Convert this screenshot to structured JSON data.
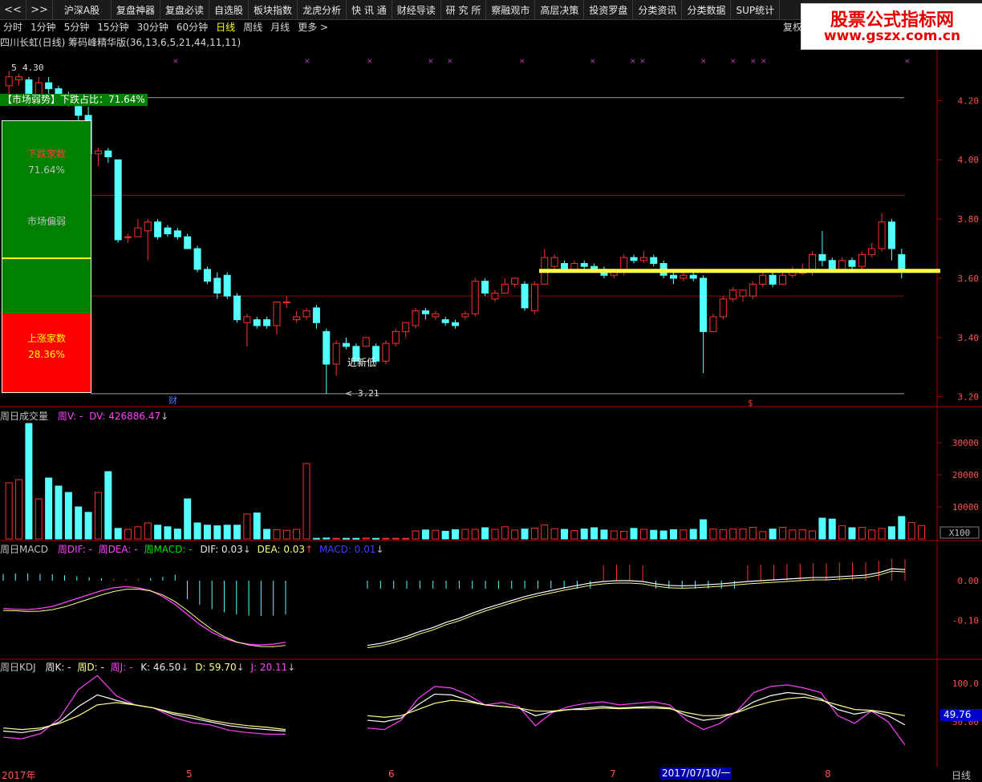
{
  "menu": {
    "nav_back": "<<",
    "nav_fwd": ">>",
    "items": [
      "沪深A股",
      "复盘神器",
      "复盘必读",
      "自选股",
      "板块指数",
      "龙虎分析",
      "快 讯 通",
      "财经导读",
      "研 究 所",
      "察融观市",
      "高层决策",
      "投资罗盘",
      "分类资讯",
      "分类数据",
      "SUP统计"
    ]
  },
  "periods": [
    "分时",
    "1分钟",
    "5分钟",
    "15分钟",
    "30分钟",
    "60分钟",
    "日线",
    "周线",
    "月线",
    "更多 >"
  ],
  "active_period": "日线",
  "restore_label": "复权",
  "watermark": {
    "line1": "股票公式指标网",
    "line2": "www.gszx.com.cn"
  },
  "chart_title": "四川长虹(日线) 筹码峰精华版(36,13,6,5,21,44,11,11)",
  "sentiment": {
    "badge": "【市场弱势】下跌占比：71.64%",
    "down_label": "下跌家数",
    "down_pct": "71.64%",
    "state": "市场偏弱",
    "up_label": "上涨家数",
    "up_pct": "28.36%",
    "colors": {
      "weak": "#008000",
      "up": "#ff0000",
      "divider": "#ffff00"
    }
  },
  "price_annotations": {
    "high_label": "4.30",
    "new_low_label": "近新低",
    "low_label": "3.21",
    "event_cai": "财",
    "event_s": "$"
  },
  "price_axis": [
    "4.20",
    "4.00",
    "3.80",
    "3.60",
    "3.40",
    "3.20"
  ],
  "volume": {
    "header_name": "周日成交量",
    "header_v": "周V: -",
    "header_dv": "DV: 426886.47",
    "axis": [
      "30000",
      "20000",
      "10000"
    ],
    "unit": "X100"
  },
  "macd": {
    "header_name": "周日MACD",
    "dif_label": "周DIF: -",
    "dea_label": "周DEA: -",
    "macd_label": "周MACD: -",
    "dif_val": "DIF: 0.03",
    "dea_val": "DEA: 0.03",
    "macd_val": "MACD: 0.01",
    "axis": [
      "0.00",
      "-0.10"
    ]
  },
  "kdj": {
    "header_name": "周日KDJ",
    "k_label": "周K: -",
    "d_label": "周D: -",
    "j_label": "周J: -",
    "k_val": "K: 46.50",
    "d_val": "D: 59.70",
    "j_val": "J: 20.11",
    "axis": [
      "100.0",
      "50.00"
    ],
    "current": "49.76"
  },
  "time_axis": {
    "labels": [
      "2017年",
      "5",
      "6",
      "7",
      "8"
    ],
    "cursor_date": "2017/07/10/一",
    "period_name": "日线"
  },
  "chart_data": {
    "type": "candlestick",
    "ylim": [
      3.18,
      4.35
    ],
    "candles": [
      [
        4.25,
        4.28,
        4.2,
        4.3
      ],
      [
        4.27,
        4.28,
        4.25,
        4.29
      ],
      [
        4.27,
        4.22,
        4.18,
        4.28
      ],
      [
        4.22,
        4.26,
        4.2,
        4.28
      ],
      [
        4.26,
        4.24,
        4.22,
        4.28
      ],
      [
        4.24,
        4.22,
        4.2,
        4.25
      ],
      [
        4.22,
        4.2,
        4.18,
        4.23
      ],
      [
        4.18,
        4.15,
        4.12,
        4.19
      ],
      [
        4.15,
        4.02,
        4.0,
        4.18
      ],
      [
        4.02,
        4.03,
        3.98,
        4.04
      ],
      [
        4.03,
        4.01,
        3.99,
        4.04
      ],
      [
        4.0,
        3.73,
        3.72,
        4.0
      ],
      [
        3.74,
        3.74,
        3.72,
        3.75
      ],
      [
        3.74,
        3.77,
        3.74,
        3.8
      ],
      [
        3.76,
        3.79,
        3.66,
        3.8
      ],
      [
        3.79,
        3.74,
        3.73,
        3.8
      ],
      [
        3.77,
        3.75,
        3.74,
        3.78
      ],
      [
        3.76,
        3.74,
        3.73,
        3.77
      ],
      [
        3.74,
        3.7,
        3.7,
        3.75
      ],
      [
        3.7,
        3.63,
        3.62,
        3.71
      ],
      [
        3.63,
        3.59,
        3.58,
        3.64
      ],
      [
        3.6,
        3.55,
        3.53,
        3.62
      ],
      [
        3.61,
        3.54,
        3.53,
        3.62
      ],
      [
        3.54,
        3.46,
        3.45,
        3.55
      ],
      [
        3.45,
        3.47,
        3.37,
        3.48
      ],
      [
        3.46,
        3.44,
        3.43,
        3.47
      ],
      [
        3.46,
        3.44,
        3.43,
        3.47
      ],
      [
        3.44,
        3.52,
        3.41,
        3.52
      ],
      [
        3.52,
        3.52,
        3.5,
        3.54
      ],
      [
        3.46,
        3.47,
        3.45,
        3.49
      ],
      [
        3.47,
        3.49,
        3.46,
        3.5
      ],
      [
        3.5,
        3.45,
        3.43,
        3.51
      ],
      [
        3.42,
        3.31,
        3.21,
        3.43
      ],
      [
        3.31,
        3.38,
        3.27,
        3.39
      ],
      [
        3.38,
        3.37,
        3.36,
        3.4
      ],
      [
        3.37,
        3.32,
        3.32,
        3.38
      ],
      [
        3.37,
        3.4,
        3.38,
        3.4
      ],
      [
        3.37,
        3.32,
        3.31,
        3.38
      ],
      [
        3.32,
        3.38,
        3.31,
        3.39
      ],
      [
        3.38,
        3.42,
        3.37,
        3.43
      ],
      [
        3.42,
        3.45,
        3.4,
        3.45
      ],
      [
        3.44,
        3.49,
        3.43,
        3.5
      ],
      [
        3.49,
        3.48,
        3.46,
        3.5
      ],
      [
        3.47,
        3.48,
        3.46,
        3.49
      ],
      [
        3.46,
        3.45,
        3.44,
        3.47
      ],
      [
        3.45,
        3.44,
        3.43,
        3.46
      ],
      [
        3.47,
        3.48,
        3.46,
        3.49
      ],
      [
        3.48,
        3.59,
        3.47,
        3.6
      ],
      [
        3.59,
        3.55,
        3.54,
        3.6
      ],
      [
        3.53,
        3.55,
        3.52,
        3.56
      ],
      [
        3.55,
        3.58,
        3.55,
        3.6
      ],
      [
        3.58,
        3.6,
        3.57,
        3.6
      ],
      [
        3.58,
        3.5,
        3.49,
        3.59
      ],
      [
        3.49,
        3.58,
        3.48,
        3.59
      ],
      [
        3.58,
        3.67,
        3.58,
        3.7
      ],
      [
        3.64,
        3.67,
        3.63,
        3.68
      ],
      [
        3.65,
        3.63,
        3.62,
        3.66
      ],
      [
        3.62,
        3.65,
        3.62,
        3.66
      ],
      [
        3.65,
        3.64,
        3.63,
        3.66
      ],
      [
        3.64,
        3.63,
        3.62,
        3.65
      ],
      [
        3.63,
        3.61,
        3.6,
        3.64
      ],
      [
        3.61,
        3.62,
        3.6,
        3.63
      ],
      [
        3.62,
        3.67,
        3.61,
        3.68
      ],
      [
        3.67,
        3.66,
        3.65,
        3.68
      ],
      [
        3.66,
        3.67,
        3.65,
        3.69
      ],
      [
        3.67,
        3.65,
        3.64,
        3.68
      ],
      [
        3.65,
        3.61,
        3.6,
        3.66
      ],
      [
        3.61,
        3.6,
        3.58,
        3.62
      ],
      [
        3.6,
        3.61,
        3.59,
        3.62
      ],
      [
        3.61,
        3.6,
        3.59,
        3.62
      ],
      [
        3.6,
        3.42,
        3.28,
        3.61
      ],
      [
        3.42,
        3.47,
        3.42,
        3.48
      ],
      [
        3.47,
        3.53,
        3.46,
        3.54
      ],
      [
        3.53,
        3.56,
        3.52,
        3.57
      ],
      [
        3.54,
        3.56,
        3.52,
        3.56
      ],
      [
        3.54,
        3.58,
        3.53,
        3.59
      ],
      [
        3.58,
        3.61,
        3.57,
        3.62
      ],
      [
        3.61,
        3.58,
        3.57,
        3.62
      ],
      [
        3.58,
        3.61,
        3.58,
        3.62
      ],
      [
        3.61,
        3.62,
        3.6,
        3.64
      ],
      [
        3.62,
        3.62,
        3.61,
        3.65
      ],
      [
        3.62,
        3.68,
        3.61,
        3.69
      ],
      [
        3.68,
        3.66,
        3.64,
        3.76
      ],
      [
        3.66,
        3.63,
        3.62,
        3.67
      ],
      [
        3.63,
        3.66,
        3.62,
        3.67
      ],
      [
        3.66,
        3.64,
        3.63,
        3.67
      ],
      [
        3.64,
        3.68,
        3.63,
        3.69
      ],
      [
        3.68,
        3.7,
        3.67,
        3.72
      ],
      [
        3.7,
        3.79,
        3.69,
        3.82
      ],
      [
        3.79,
        3.7,
        3.66,
        3.8
      ],
      [
        3.68,
        3.63,
        3.6,
        3.7
      ]
    ],
    "volumes": [
      17500,
      18500,
      36000,
      12500,
      19000,
      16500,
      14500,
      10000,
      8300,
      14500,
      21000,
      3300,
      3000,
      3800,
      5000,
      4300,
      3800,
      3100,
      12500,
      5000,
      4300,
      4100,
      4300,
      4300,
      7800,
      8100,
      3000,
      2900,
      2700,
      3000,
      23500,
      200,
      300,
      200,
      200,
      200,
      300,
      200,
      200,
      200,
      200,
      2500,
      2800,
      2700,
      2400,
      2900,
      3000,
      3000,
      3500,
      3000,
      3800,
      2800,
      3100,
      3400,
      4400,
      3200,
      3000,
      2600,
      3100,
      3500,
      2800,
      2500,
      2400,
      3300,
      3000,
      2700,
      2500,
      2900,
      2800,
      3000,
      6000,
      3100,
      2900,
      3100,
      3100,
      3600,
      2300,
      3100,
      3600,
      2800,
      2900,
      2500,
      6500,
      6200,
      4100,
      3500,
      3600,
      2800,
      3300,
      3800,
      7000,
      5100,
      4200
    ],
    "support_line": 3.625,
    "ref_lines": [
      4.21,
      3.88,
      3.54,
      3.21
    ],
    "macd_dif": [
      -0.07,
      -0.072,
      -0.073,
      -0.07,
      -0.065,
      -0.055,
      -0.045,
      -0.035,
      -0.025,
      -0.018,
      -0.015,
      -0.018,
      -0.025,
      -0.04,
      -0.06,
      -0.085,
      -0.11,
      -0.13,
      -0.145,
      -0.155,
      -0.16,
      -0.162,
      -0.16,
      -0.155,
      -0.163,
      -0.158,
      -0.15,
      -0.14,
      -0.128,
      -0.118,
      -0.105,
      -0.095,
      -0.082,
      -0.07,
      -0.06,
      -0.05,
      -0.04,
      -0.032,
      -0.025,
      -0.018,
      -0.012,
      -0.006,
      -0.002,
      0.0,
      0.0,
      -0.002,
      -0.008,
      -0.012,
      -0.013,
      -0.012,
      -0.01,
      -0.008,
      -0.005,
      -0.002,
      0.0,
      0.002,
      0.004,
      0.006,
      0.008,
      0.008,
      0.01,
      0.012,
      0.014,
      0.02,
      0.03,
      0.028
    ],
    "kdj_k": [
      38,
      36,
      40,
      50,
      70,
      85,
      78,
      72,
      68,
      60,
      55,
      50,
      45,
      42,
      40,
      38
    ],
    "kdj_d": [
      42,
      40,
      42,
      48,
      58,
      72,
      75,
      72,
      68,
      62,
      58,
      52,
      48,
      45,
      43,
      40
    ],
    "kdj_j": [
      30,
      28,
      35,
      55,
      92,
      110,
      84,
      72,
      68,
      56,
      49,
      46,
      39,
      36,
      34,
      34
    ]
  }
}
